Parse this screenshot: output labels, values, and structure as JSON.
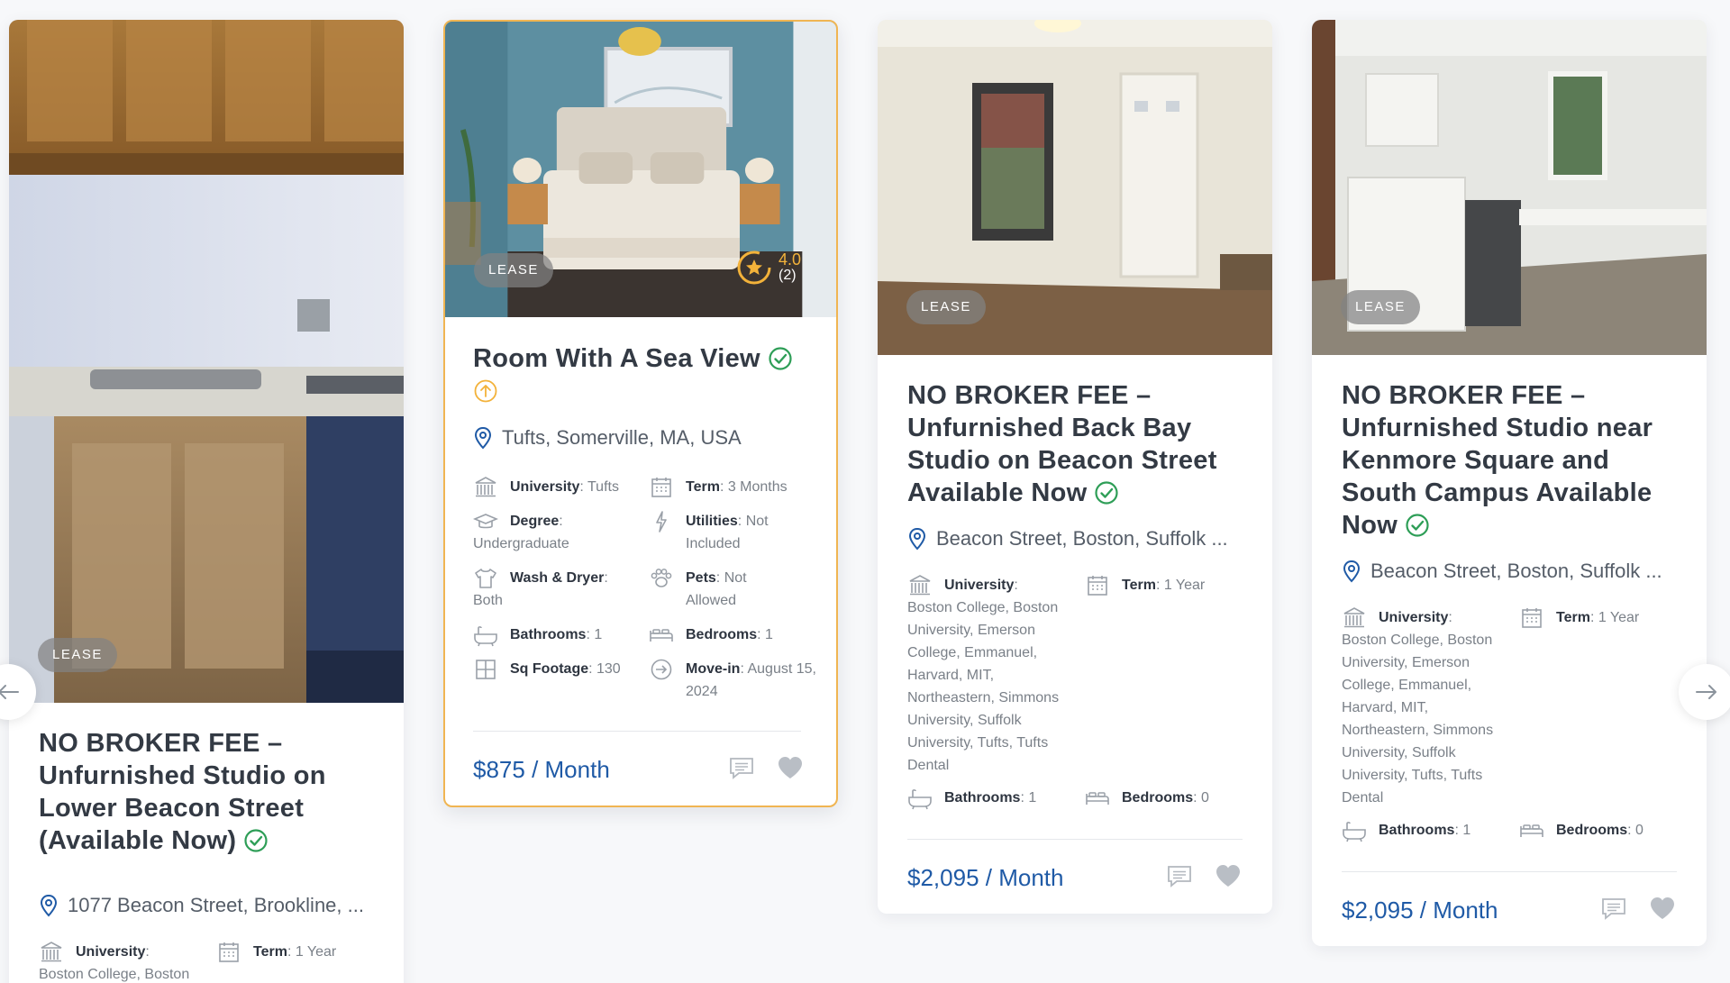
{
  "nav": {
    "prev_label": "Previous",
    "next_label": "Next"
  },
  "cards": [
    {
      "badge": "LEASE",
      "title": "NO BROKER FEE – Unfurnished Studio on Lower Beacon Street (Available Now)",
      "address": "1077 Beacon Street, Brookline, ...",
      "attrs": {
        "university_label": "University",
        "university_value": "Boston College, Boston University,",
        "term_label": "Term",
        "term_value": "1 Year"
      }
    },
    {
      "badge": "LEASE",
      "rating": {
        "score": "4.0",
        "count": "(2)"
      },
      "title": "Room With A Sea View",
      "address": "Tufts, Somerville, MA, USA",
      "attrs": {
        "university_label": "University",
        "university_value": "Tufts",
        "term_label": "Term",
        "term_value": "3 Months",
        "degree_label": "Degree",
        "degree_value": "Undergraduate",
        "utilities_label": "Utilities",
        "utilities_value": "Not Included",
        "wash_label": "Wash & Dryer",
        "wash_value": "Both",
        "pets_label": "Pets",
        "pets_value": "Not Allowed",
        "bathrooms_label": "Bathrooms",
        "bathrooms_value": "1",
        "bedrooms_label": "Bedrooms",
        "bedrooms_value": "1",
        "sqft_label": "Sq Footage",
        "sqft_value": "130",
        "movein_label": "Move-in",
        "movein_value": "August 15, 2024"
      },
      "price": "$875 / Month"
    },
    {
      "badge": "LEASE",
      "title": "NO BROKER FEE – Unfurnished Back Bay Studio on Beacon Street Available Now",
      "address": "Beacon Street, Boston, Suffolk ...",
      "attrs": {
        "university_label": "University",
        "university_value": "Boston College, Boston University, Emerson College, Emmanuel, Harvard, MIT, Northeastern, Simmons University, Suffolk University, Tufts, Tufts Dental",
        "term_label": "Term",
        "term_value": "1 Year",
        "bathrooms_label": "Bathrooms",
        "bathrooms_value": "1",
        "bedrooms_label": "Bedrooms",
        "bedrooms_value": "0"
      },
      "price": "$2,095 / Month"
    },
    {
      "badge": "LEASE",
      "title": "NO BROKER FEE – Unfurnished Studio near Kenmore Square and South Campus Available Now",
      "address": "Beacon Street, Boston, Suffolk ...",
      "attrs": {
        "university_label": "University",
        "university_value": "Boston College, Boston University, Emerson College, Emmanuel, Harvard, MIT, Northeastern, Simmons University, Suffolk University, Tufts, Tufts Dental",
        "term_label": "Term",
        "term_value": "1 Year",
        "bathrooms_label": "Bathrooms",
        "bathrooms_value": "1",
        "bedrooms_label": "Bedrooms",
        "bedrooms_value": "0"
      },
      "price": "$2,095 / Month"
    }
  ],
  "colors": {
    "accent": "#1f5aa6",
    "verified": "#2e9e57",
    "rating": "#f3b23a",
    "active_border": "#f0b552",
    "icon_gray": "#9aa0a8"
  }
}
